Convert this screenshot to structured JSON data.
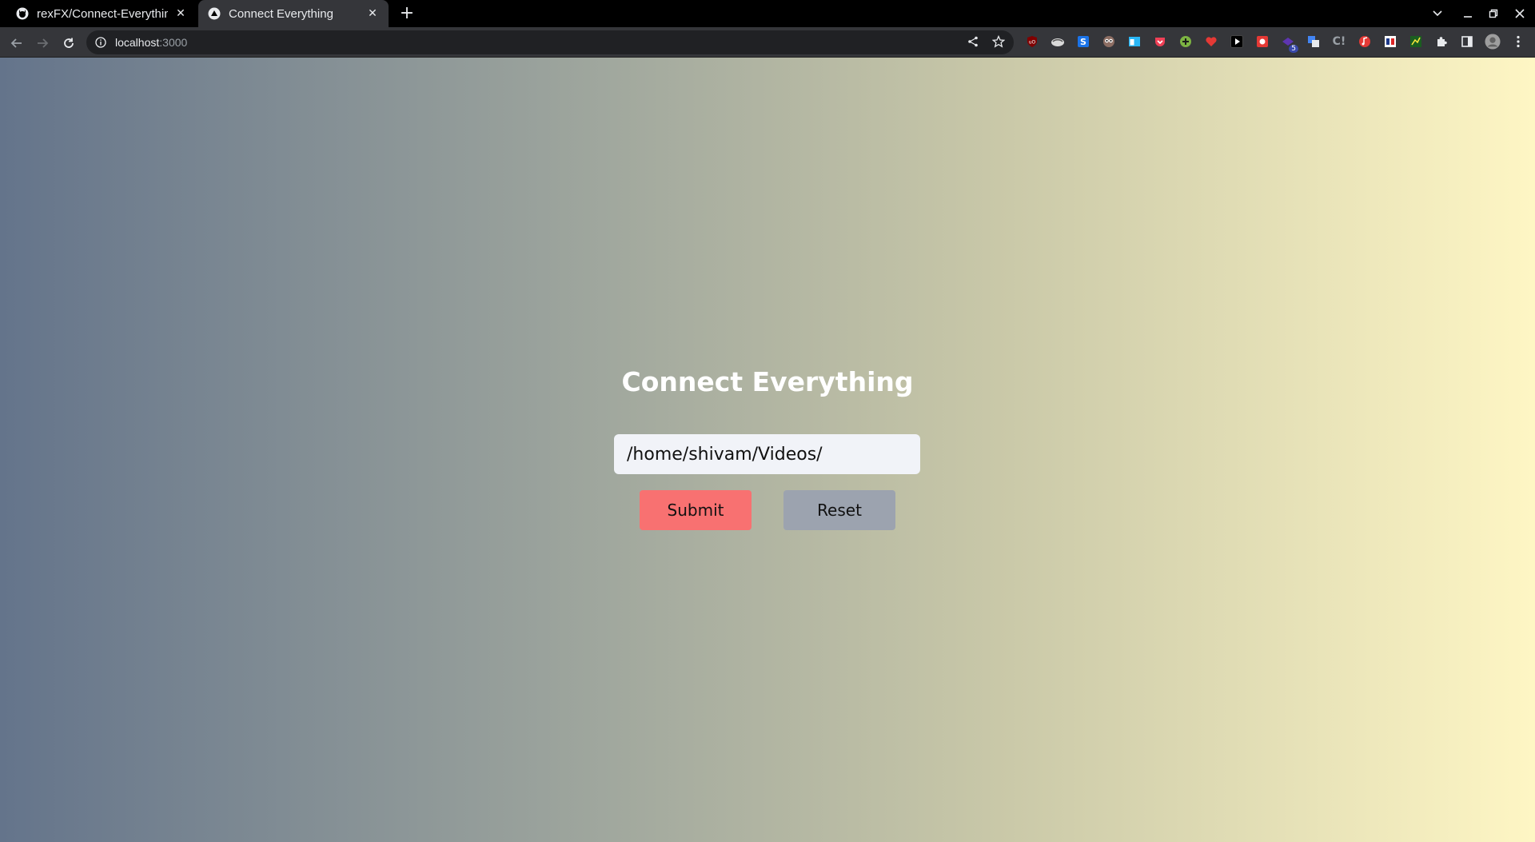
{
  "browser": {
    "tabs": [
      {
        "title": "rexFX/Connect-Everything",
        "favicon": "github-icon",
        "active": false
      },
      {
        "title": "Connect Everything",
        "favicon": "app-triangle-icon",
        "active": true
      }
    ],
    "new_tab_icon": "plus-icon",
    "address": {
      "host": "localhost",
      "port": ":3000"
    },
    "extensions": [
      "ublock-icon",
      "tampermonkey-icon",
      "extension-s-icon",
      "owl-icon",
      "window-icon",
      "pocket-icon",
      "plus-circle-icon",
      "heart-icon",
      "play-icon",
      "bug-icon",
      "wallet-icon",
      "translate-icon",
      "ci-icon",
      "music-icon",
      "flag-icon",
      "graph-icon",
      "puzzle-icon",
      "sidepanel-icon",
      "profile-avatar",
      "menu-icon"
    ],
    "extension_badge": "5"
  },
  "page": {
    "heading": "Connect Everything",
    "path_input": {
      "value": "/home/shivam/Videos/"
    },
    "submit_label": "Submit",
    "reset_label": "Reset"
  },
  "colors": {
    "gradient_start": "#64748b",
    "gradient_end": "#fef6c4",
    "submit_bg": "#f87171",
    "reset_bg": "#9ca3af"
  }
}
